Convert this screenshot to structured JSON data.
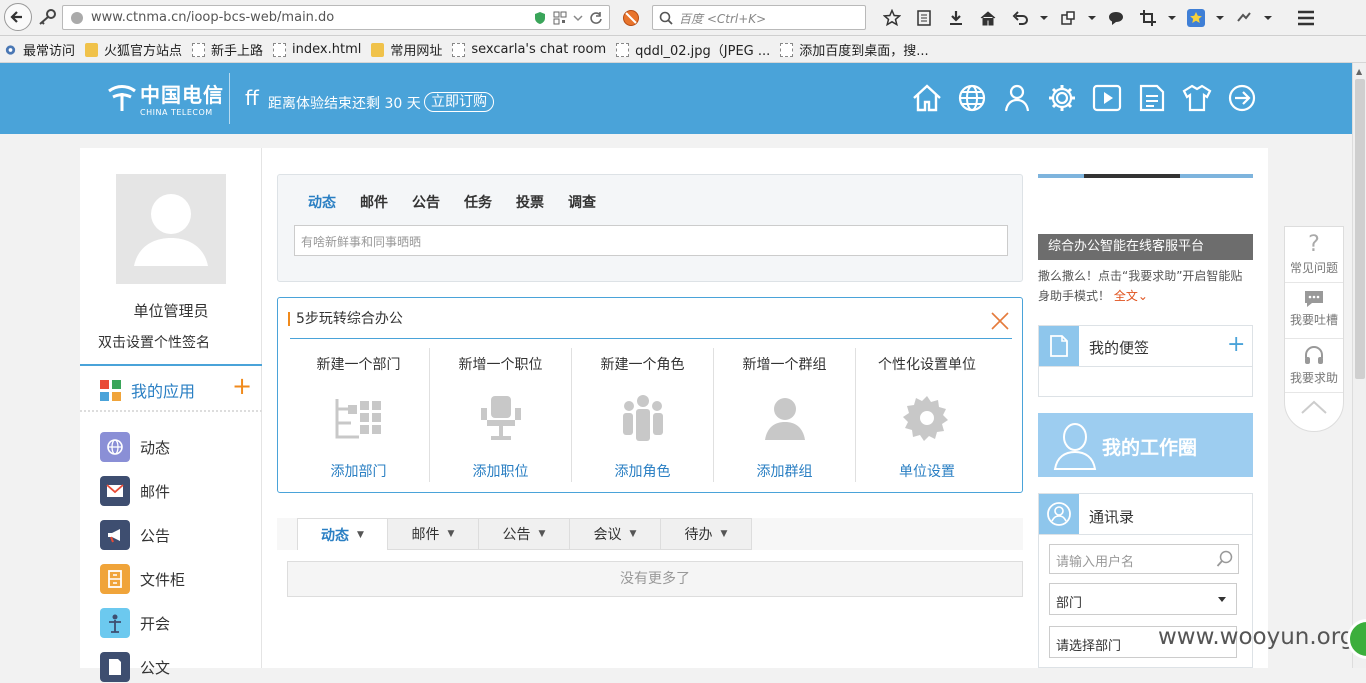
{
  "browser": {
    "url": "www.ctnma.cn/ioop-bcs-web/main.do",
    "search_placeholder": "百度 <Ctrl+K>"
  },
  "bookmarks": [
    {
      "label": "最常访问",
      "icon": "gear-icon"
    },
    {
      "label": "火狐官方站点",
      "icon": "folder-icon"
    },
    {
      "label": "新手上路",
      "icon": "page-icon"
    },
    {
      "label": "index.html",
      "icon": "page-icon"
    },
    {
      "label": "常用网址",
      "icon": "folder-icon"
    },
    {
      "label": "sexcarla's chat room",
      "icon": "page-icon"
    },
    {
      "label": "qddl_02.jpg（JPEG ...",
      "icon": "page-icon"
    },
    {
      "label": "添加百度到桌面，搜...",
      "icon": "page-icon"
    }
  ],
  "header": {
    "logo_cn": "中国电信",
    "logo_en": "CHINA TELECOM",
    "user": "ff",
    "trial_text": "距离体验结束还剩 30 天",
    "buy_label": "立即订购",
    "icons": [
      "home-icon",
      "globe-icon",
      "user-icon",
      "gear-icon",
      "play-icon",
      "document-icon",
      "shirt-icon",
      "logout-icon"
    ]
  },
  "left": {
    "role": "单位管理员",
    "signature": "双击设置个性签名",
    "apps_title": "我的应用",
    "apps_add": "+",
    "apps": [
      {
        "label": "动态",
        "color": "#8a8fd6"
      },
      {
        "label": "邮件",
        "color": "#3e4e70"
      },
      {
        "label": "公告",
        "color": "#3e4e70"
      },
      {
        "label": "文件柜",
        "color": "#f0a43a"
      },
      {
        "label": "开会",
        "color": "#6cc9ef"
      },
      {
        "label": "公文",
        "color": "#3e4e70"
      }
    ]
  },
  "post": {
    "tabs": [
      "动态",
      "邮件",
      "公告",
      "任务",
      "投票",
      "调查"
    ],
    "placeholder": "有啥新鲜事和同事晒晒"
  },
  "steps": {
    "title": "5步玩转综合办公",
    "items": [
      {
        "title": "新建一个部门",
        "link": "添加部门"
      },
      {
        "title": "新增一个职位",
        "link": "添加职位"
      },
      {
        "title": "新建一个角色",
        "link": "添加角色"
      },
      {
        "title": "新增一个群组",
        "link": "添加群组"
      },
      {
        "title": "个性化设置单位",
        "link": "单位设置"
      }
    ]
  },
  "feed": {
    "tabs": [
      "动态",
      "邮件",
      "公告",
      "会议",
      "待办"
    ],
    "empty": "没有更多了"
  },
  "right": {
    "banner_label": "综合办公智能在线客服平台",
    "help_text": "撒么撒么！点击“我要求助”开启智能贴身助手模式！",
    "help_more": "全文",
    "notes_title": "我的便签",
    "notes_add": "+",
    "work_title": "我的工作圈",
    "contacts_title": "通讯录",
    "contacts_search": "请输入用户名",
    "dept_select": "部门",
    "dept_choose": "请选择部门"
  },
  "float_help": [
    {
      "label": "常见问题",
      "icon": "question-icon"
    },
    {
      "label": "我要吐槽",
      "icon": "chat-icon"
    },
    {
      "label": "我要求助",
      "icon": "headset-icon"
    }
  ],
  "watermark": "www.wooyun.org",
  "colors": {
    "brand": "#4aa3d9",
    "accent": "#f08a1c",
    "link": "#2a7fc3"
  }
}
